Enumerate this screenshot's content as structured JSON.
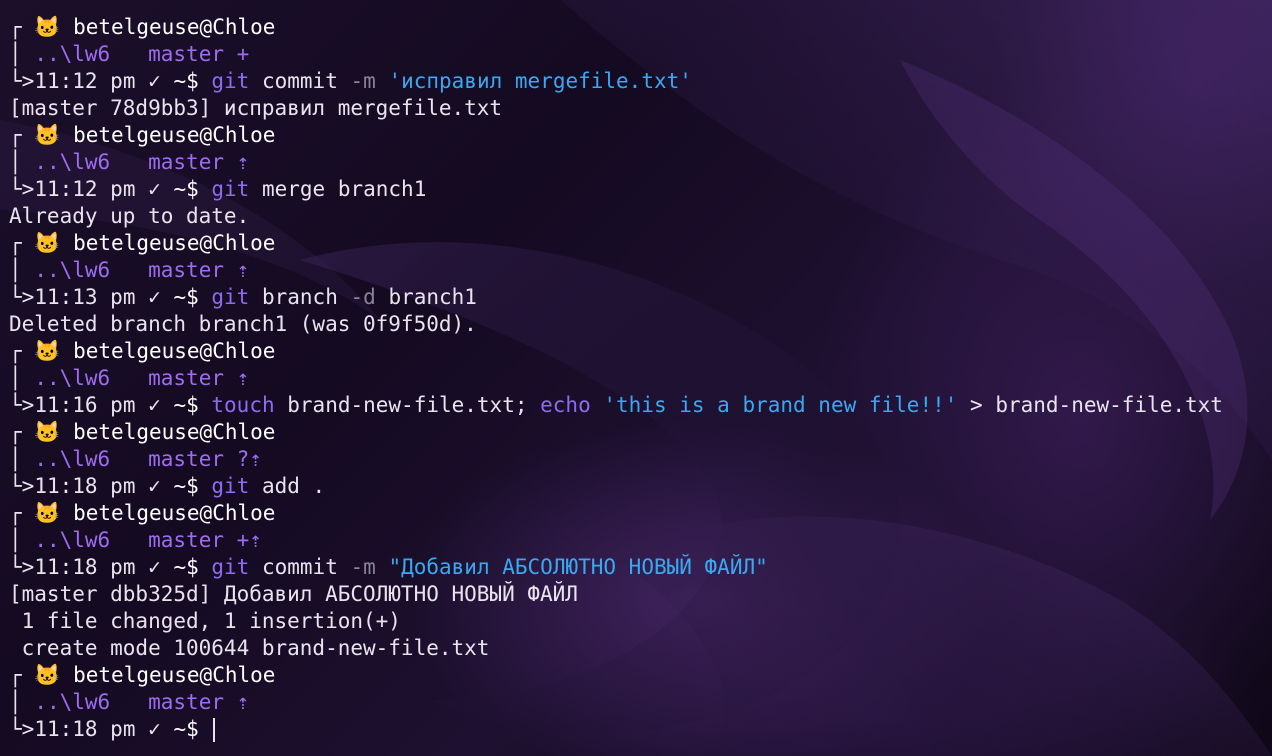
{
  "prompt": {
    "corner_top": "┌",
    "pipe": "│",
    "corner_bottom": "└",
    "arrow": ">",
    "cat_icon": "🐱",
    "user_host": "betelgeuse@Chloe",
    "path": "..\\lw6",
    "branch_icon": "",
    "branch": "master",
    "check": "✓",
    "tilde_dollar": "~$"
  },
  "blocks": [
    {
      "status": "+",
      "time": "11:12 pm",
      "cmd": "git",
      "parts": [
        {
          "t": "arg",
          "v": "commit"
        },
        {
          "t": "flag",
          "v": "-m"
        },
        {
          "t": "str",
          "v": "'исправил mergefile.txt'"
        }
      ],
      "output": [
        "[master 78d9bb3] исправил mergefile.txt"
      ]
    },
    {
      "status": "⇡",
      "time": "11:12 pm",
      "cmd": "git",
      "parts": [
        {
          "t": "arg",
          "v": "merge branch1"
        }
      ],
      "output": [
        "Already up to date."
      ]
    },
    {
      "status": "⇡",
      "time": "11:13 pm",
      "cmd": "git",
      "parts": [
        {
          "t": "arg",
          "v": "branch"
        },
        {
          "t": "flag",
          "v": "-d"
        },
        {
          "t": "arg",
          "v": "branch1"
        }
      ],
      "output": [
        "Deleted branch branch1 (was 0f9f50d)."
      ]
    },
    {
      "status": "⇡",
      "time": "11:16 pm",
      "cmd": "touch",
      "parts": [
        {
          "t": "arg",
          "v": "brand-new-file.txt;"
        },
        {
          "t": "cmd",
          "v": "echo"
        },
        {
          "t": "str",
          "v": "'this is a brand new file!!'"
        },
        {
          "t": "arg",
          "v": "> brand-new-file.txt"
        }
      ],
      "output": []
    },
    {
      "status": "?⇡",
      "time": "11:18 pm",
      "cmd": "git",
      "parts": [
        {
          "t": "arg",
          "v": "add ."
        }
      ],
      "output": []
    },
    {
      "status": "+⇡",
      "time": "11:18 pm",
      "cmd": "git",
      "parts": [
        {
          "t": "arg",
          "v": "commit"
        },
        {
          "t": "flag",
          "v": "-m"
        },
        {
          "t": "str",
          "v": "\"Добавил АБСОЛЮТНО НОВЫЙ ФАЙЛ\""
        }
      ],
      "output": [
        "[master dbb325d] Добавил АБСОЛЮТНО НОВЫЙ ФАЙЛ",
        " 1 file changed, 1 insertion(+)",
        " create mode 100644 brand-new-file.txt"
      ]
    },
    {
      "status": "⇡",
      "time": "11:18 pm",
      "cmd": "",
      "parts": [],
      "output": [],
      "cursor": true
    }
  ],
  "colors": {
    "path": "#9e6cf0",
    "command": "#8e6bf2",
    "string": "#3aa8f0",
    "flag": "#8a8496",
    "text": "#e8e4ee",
    "background": "#140a21"
  }
}
